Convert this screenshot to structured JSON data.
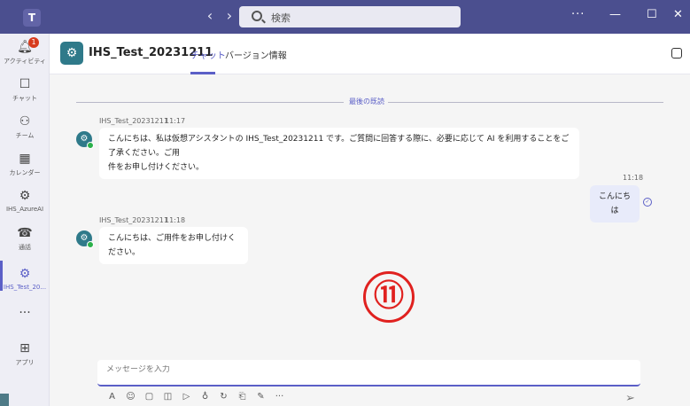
{
  "titlebar": {
    "search_placeholder": "検索",
    "more": "···",
    "minimize": "—",
    "maximize": "☐",
    "close": "✕"
  },
  "rail": {
    "items": [
      {
        "label": "アクティビティ",
        "icon": "bell-icon",
        "badge": "1"
      },
      {
        "label": "チャット",
        "icon": "chat-icon"
      },
      {
        "label": "チーム",
        "icon": "teams-icon"
      },
      {
        "label": "カレンダー",
        "icon": "calendar-icon"
      },
      {
        "label": "IHS_AzureAI",
        "icon": "bot-icon"
      },
      {
        "label": "通話",
        "icon": "phone-icon"
      },
      {
        "label": "IHS_Test_20...",
        "icon": "bot-icon"
      },
      {
        "label": "アプリ",
        "icon": "add-app-icon"
      }
    ],
    "more": "···"
  },
  "header": {
    "title": "IHS_Test_20231211",
    "tabs": [
      {
        "label": "チャット",
        "active": true
      },
      {
        "label": "バージョン情報",
        "active": false
      }
    ]
  },
  "chat": {
    "divider_label": "最後の既読",
    "messages": [
      {
        "sender": "IHS_Test_20231211",
        "time": "11:17",
        "text_line1": "こんにちは、私は仮想アシスタントの IHS_Test_20231211 です。ご質問に回答する際に、必要に応じて AI を利用することをご了承ください。ご用",
        "text_line2": "件をお申し付けください。"
      },
      {
        "sender": "",
        "time": "11:18",
        "text": "こんにちは"
      },
      {
        "sender": "IHS_Test_20231211",
        "time": "11:18",
        "text": "こんにちは、ご用件をお申し付けください。"
      }
    ],
    "annotation_marker": "⑪"
  },
  "composer": {
    "placeholder": "メッセージを入力"
  },
  "colors": {
    "titlebar": "#4b4f8f",
    "accent": "#5b5fc7",
    "bot": "#2f7a8a",
    "badge": "#d73a1d",
    "marker": "#e0211f"
  }
}
